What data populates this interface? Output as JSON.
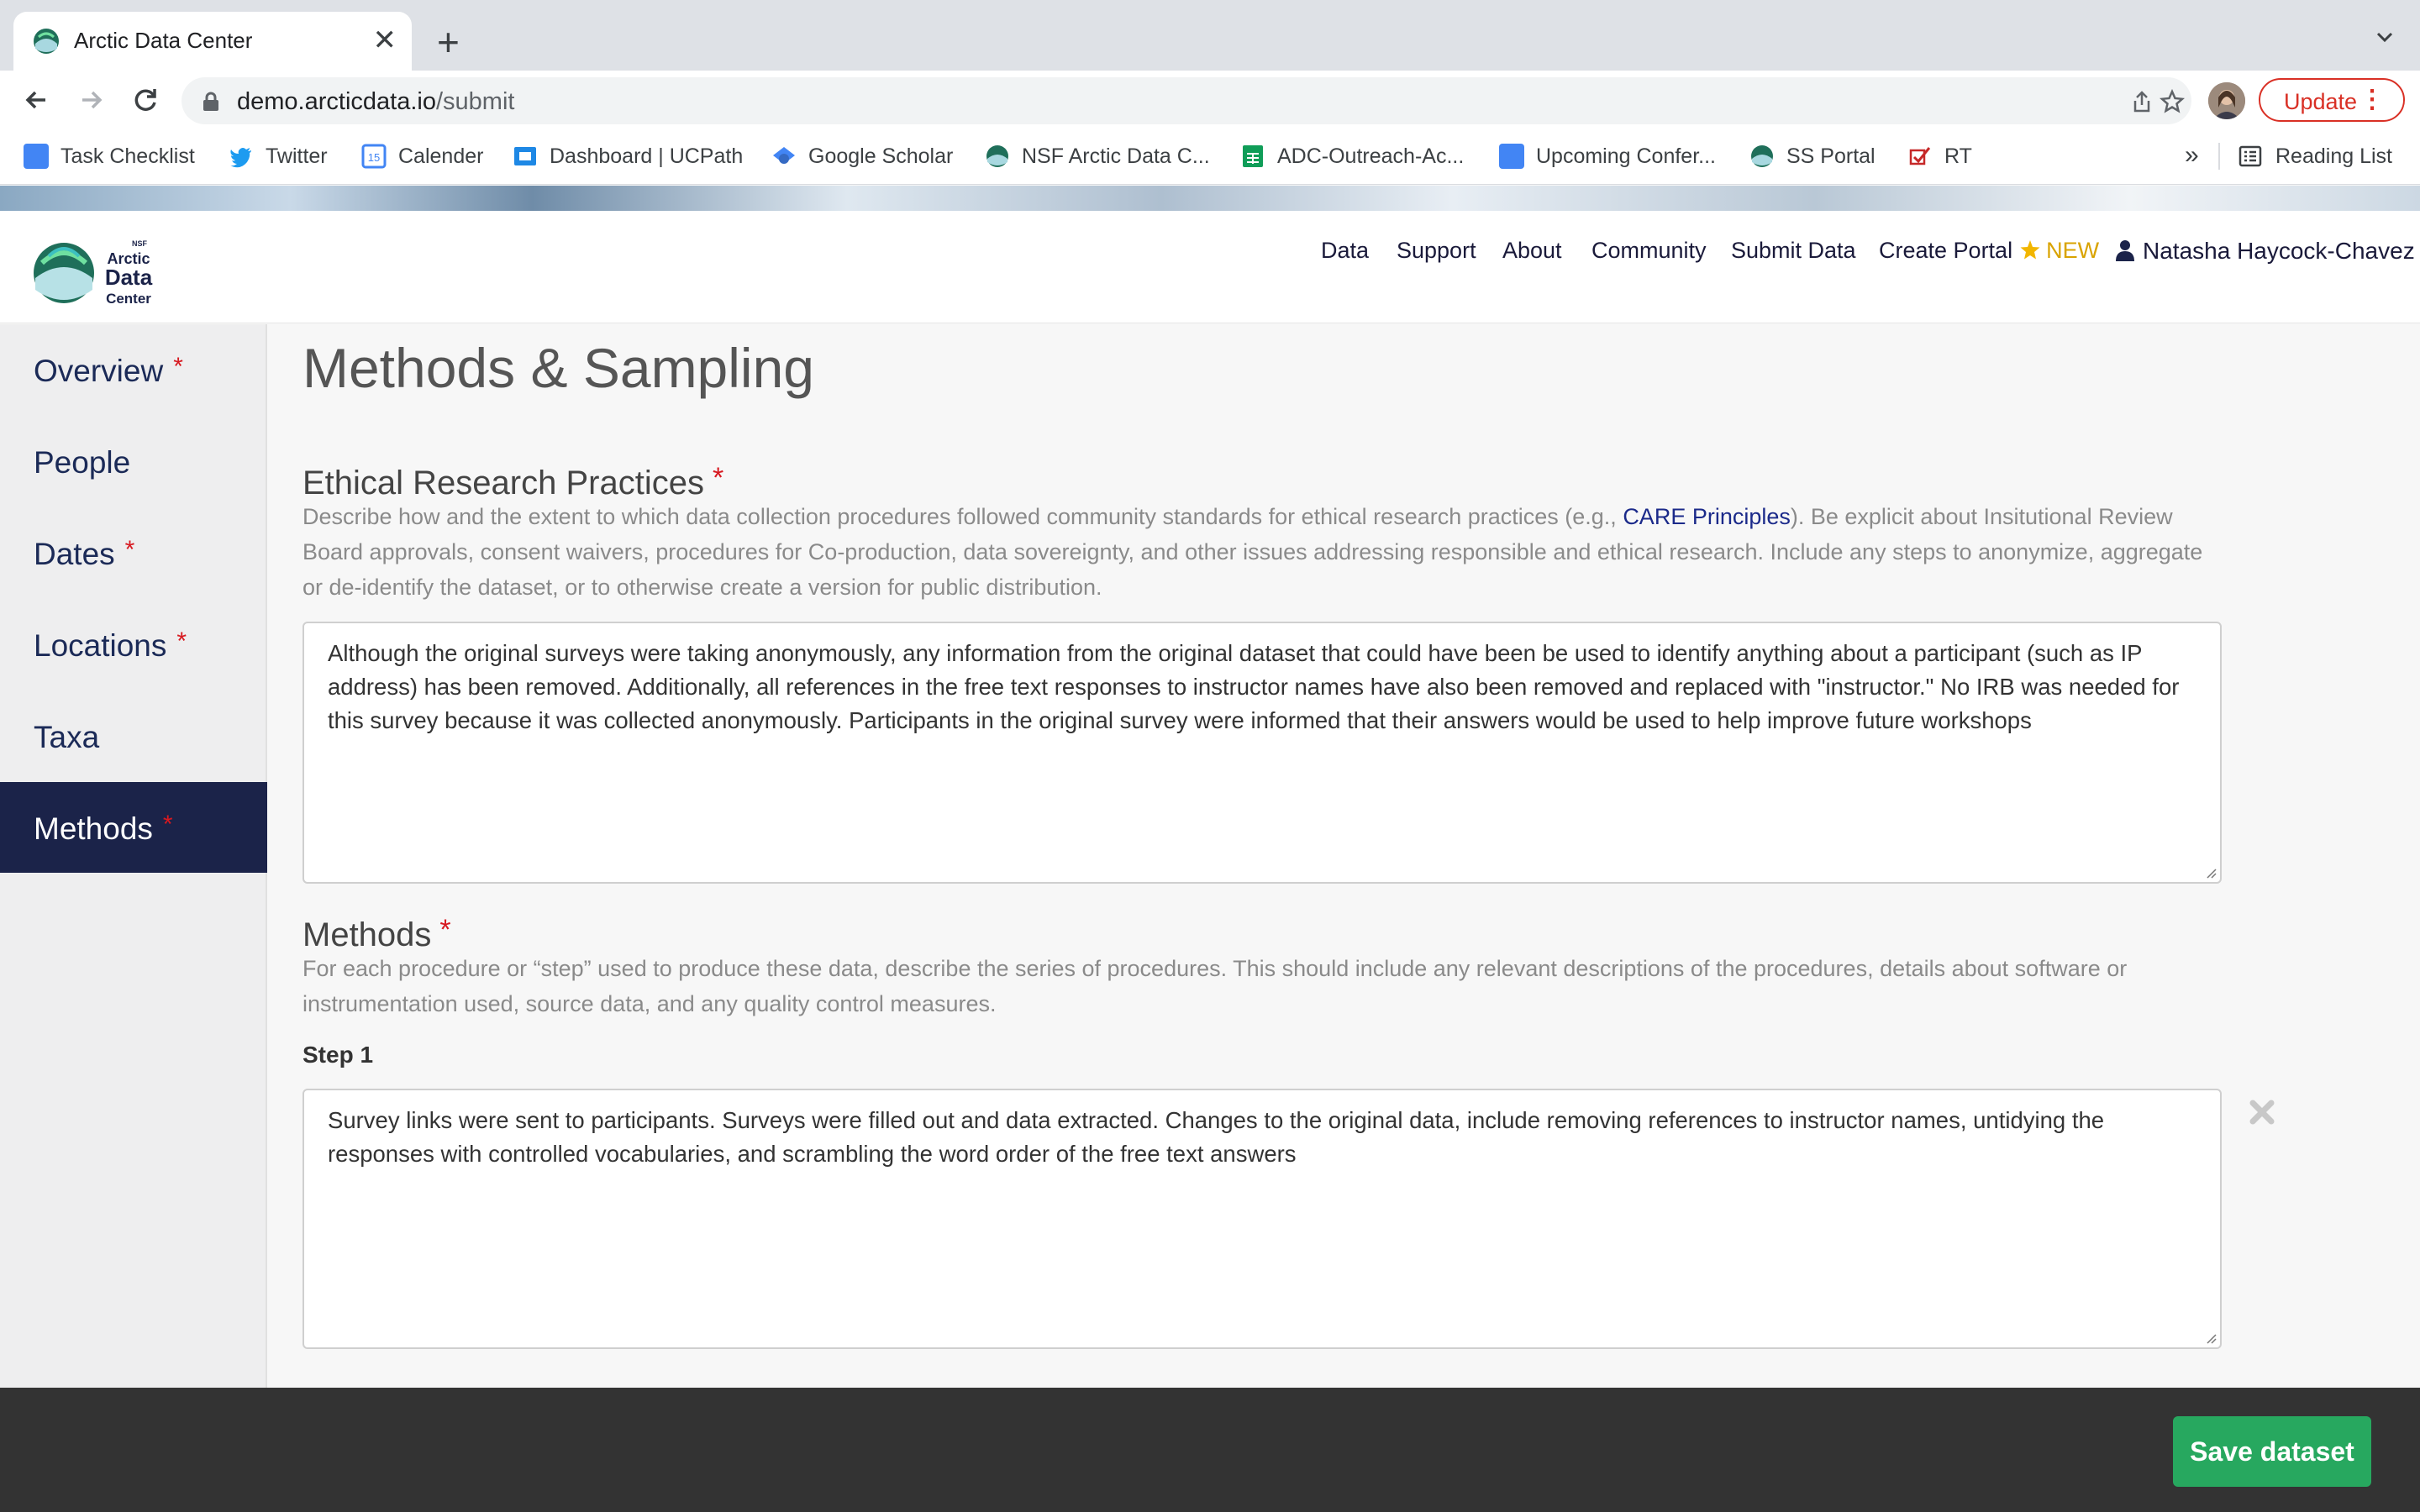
{
  "browser": {
    "tab_title": "Arctic Data Center",
    "url_host": "demo.arcticdata.io",
    "url_path": "/submit",
    "update_label": "Update",
    "bookmarks": [
      {
        "label": "Task Checklist",
        "icon": "docs-icon"
      },
      {
        "label": "Twitter",
        "icon": "twitter-icon"
      },
      {
        "label": "Calender",
        "icon": "calendar-icon"
      },
      {
        "label": "Dashboard | UCPath",
        "icon": "ucpath-icon"
      },
      {
        "label": "Google Scholar",
        "icon": "scholar-icon"
      },
      {
        "label": "NSF Arctic Data C...",
        "icon": "arctic-icon"
      },
      {
        "label": "ADC-Outreach-Ac...",
        "icon": "sheets-icon"
      },
      {
        "label": "Upcoming Confer...",
        "icon": "docs-icon"
      },
      {
        "label": "SS Portal",
        "icon": "arctic-icon"
      },
      {
        "label": "RT",
        "icon": "rt-icon"
      }
    ],
    "bookmarks_more": "»",
    "reading_list": "Reading List"
  },
  "site": {
    "nav": {
      "data": "Data",
      "support": "Support",
      "about": "About",
      "community": "Community",
      "submit": "Submit Data",
      "create_portal": "Create Portal",
      "new_badge": "NEW"
    },
    "user_name": "Natasha Haycock-Chavez"
  },
  "sidebar": {
    "items": [
      {
        "label": "Overview",
        "required": "*"
      },
      {
        "label": "People",
        "required": ""
      },
      {
        "label": "Dates",
        "required": "*"
      },
      {
        "label": "Locations",
        "required": "*"
      },
      {
        "label": "Taxa",
        "required": ""
      },
      {
        "label": "Methods",
        "required": "*"
      }
    ]
  },
  "main": {
    "title": "Methods & Sampling",
    "ethics": {
      "title": "Ethical Research Practices",
      "required": "*",
      "help_before": "Describe how and the extent to which data collection procedures followed community standards for ethical research practices (e.g., ",
      "help_link": "CARE Principles",
      "help_after": "). Be explicit about Insitutional Review Board approvals, consent waivers, procedures for Co-production, data sovereignty, and other issues addressing responsible and ethical research. Include any steps to anonymize, aggregate or de-identify the dataset, or to otherwise create a version for public distribution.",
      "value": "Although the original surveys were taking anonymously, any information from the original dataset that could have been be used to identify anything about a participant (such as IP address) has been removed. Additionally, all references in the free text responses to instructor names have also been removed and replaced with \"instructor.\" No IRB was needed for this survey because it was collected anonymously. Participants in the original survey were informed that their answers would be used to help improve future workshops"
    },
    "methods": {
      "title": "Methods",
      "required": "*",
      "help": "For each procedure or “step” used to produce these data, describe the series of procedures. This should include any relevant descriptions of the procedures, details about software or instrumentation used, source data, and any quality control measures.",
      "step_label": "Step 1",
      "step_value": "Survey links were sent to participants. Surveys were filled out and data extracted. Changes to the original data, include removing references to instructor names, untidying the responses with controlled vocabularies, and scrambling the word order of the free text answers"
    }
  },
  "footer": {
    "save_label": "Save dataset"
  }
}
